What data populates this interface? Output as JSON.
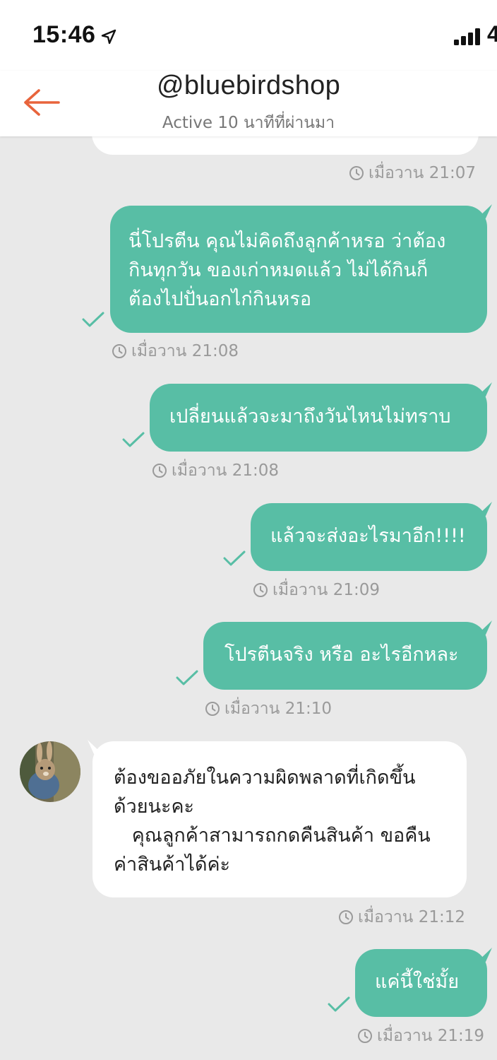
{
  "status_bar": {
    "time": "15:46",
    "network": "4"
  },
  "header": {
    "title": "@bluebirdshop",
    "subtitle": "Active 10 นาทีที่ผ่านมา"
  },
  "colors": {
    "accent": "#e8643c",
    "outgoing_bubble": "#58bea5",
    "incoming_bubble": "#ffffff",
    "background": "#e9e9e9"
  },
  "messages": [
    {
      "direction": "incoming",
      "text": "",
      "time": "เมื่อวาน 21:07"
    },
    {
      "direction": "outgoing",
      "text": "นี่โปรตีน คุณไม่คิดถึงลูกค้าหรอ ว่าต้อง\nกินทุกวัน ของเก่าหมดแล้ว ไม่ได้กินก็\nต้องไปปั่นอกไก่กินหรอ",
      "time": "เมื่อวาน 21:08"
    },
    {
      "direction": "outgoing",
      "text": "เปลี่ยนแล้วจะมาถึงวันไหนไม่ทราบ",
      "time": "เมื่อวาน 21:08"
    },
    {
      "direction": "outgoing",
      "text": "แล้วจะส่งอะไรมาอีก!!!!",
      "time": "เมื่อวาน 21:09"
    },
    {
      "direction": "outgoing",
      "text": "โปรตีนจริง หรือ อะไรอีกหละ",
      "time": "เมื่อวาน 21:10"
    },
    {
      "direction": "incoming",
      "text": "ต้องขออภัยในความผิดพลาดที่เกิดขึ้น\nด้วยนะคะ\n   คุณลูกค้าสามารถกดคืนสินค้า ขอคืน\nค่าสินค้าได้ค่ะ",
      "time": "เมื่อวาน 21:12"
    },
    {
      "direction": "outgoing",
      "text": "แค่นี้ใช่มั้ย",
      "time": "เมื่อวาน 21:19"
    }
  ]
}
